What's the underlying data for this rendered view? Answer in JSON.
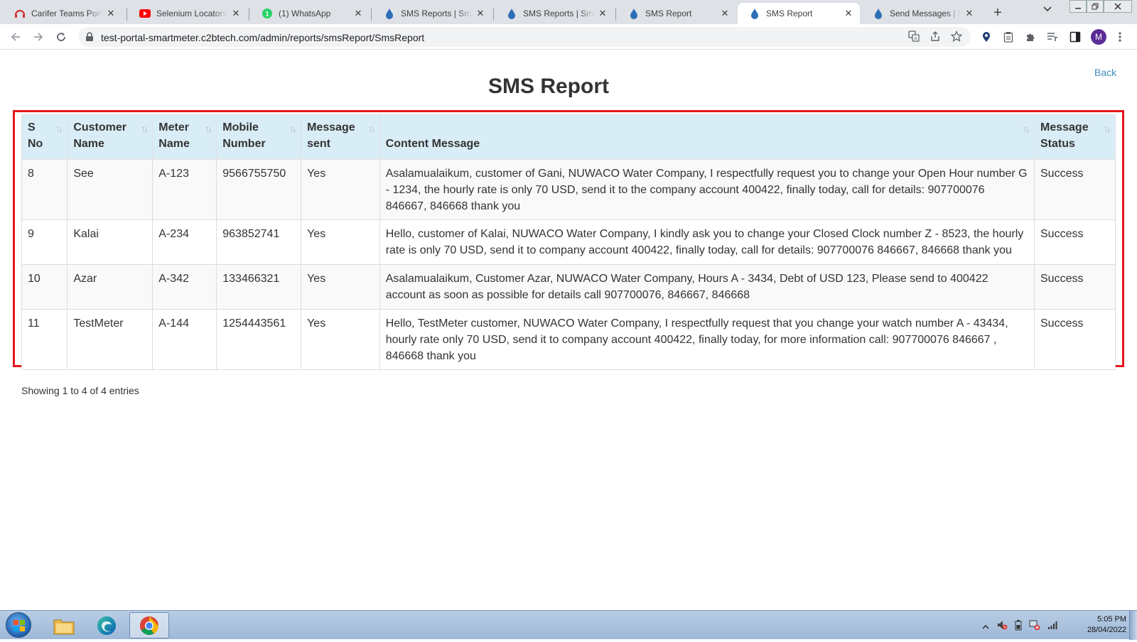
{
  "browser": {
    "tabs": [
      {
        "title": "Carifer Teams Portal",
        "icon": "headset-icon"
      },
      {
        "title": "Selenium Locators - ",
        "icon": "youtube-icon"
      },
      {
        "title": "(1) WhatsApp",
        "icon": "whatsapp-icon"
      },
      {
        "title": "SMS Reports | Smart",
        "icon": "water-drop-icon"
      },
      {
        "title": "SMS Reports | Smart",
        "icon": "water-drop-icon"
      },
      {
        "title": "SMS Report",
        "icon": "water-drop-icon"
      },
      {
        "title": "SMS Report",
        "icon": "water-drop-icon",
        "active": true
      },
      {
        "title": "Send Messages | Sm",
        "icon": "water-drop-icon"
      }
    ],
    "url": "test-portal-smartmeter.c2btech.com/admin/reports/smsReport/SmsReport",
    "profile_initial": "M"
  },
  "page": {
    "title": "SMS Report",
    "back_label": "Back"
  },
  "table": {
    "headers": [
      {
        "line1": "S",
        "line2": "No"
      },
      {
        "line1": "Customer",
        "line2": "Name"
      },
      {
        "line1": "Meter",
        "line2": "Name"
      },
      {
        "line1": "Mobile",
        "line2": "Number"
      },
      {
        "line1": "Message",
        "line2": "sent"
      },
      {
        "line1": "",
        "line2": "Content Message"
      },
      {
        "line1": "Message",
        "line2": "Status"
      }
    ],
    "rows": [
      {
        "sno": "8",
        "customer": "See",
        "meter": "A-123",
        "mobile": "9566755750",
        "sent": "Yes",
        "content": "Asalamualaikum, customer of Gani, NUWACO Water Company, I respectfully request you to change your Open Hour number G - 1234, the hourly rate is only 70 USD, send it to the company account 400422, finally today, call for details: 907700076 846667, 846668 thank you",
        "status": "Success"
      },
      {
        "sno": "9",
        "customer": "Kalai",
        "meter": "A-234",
        "mobile": "963852741",
        "sent": "Yes",
        "content": "Hello, customer of Kalai, NUWACO Water Company, I kindly ask you to change your Closed Clock number Z - 8523, the hourly rate is only 70 USD, send it to company account 400422, finally today, call for details: 907700076 846667, 846668 thank you",
        "status": "Success"
      },
      {
        "sno": "10",
        "customer": "Azar",
        "meter": "A-342",
        "mobile": "133466321",
        "sent": "Yes",
        "content": "Asalamualaikum, Customer Azar, NUWACO Water Company, Hours A - 3434, Debt of USD 123, Please send to 400422 account as soon as possible for details call 907700076, 846667, 846668",
        "status": "Success"
      },
      {
        "sno": "11",
        "customer": "TestMeter",
        "meter": "A-144",
        "mobile": "1254443561",
        "sent": "Yes",
        "content": "Hello, TestMeter customer, NUWACO Water Company, I respectfully request that you change your watch number A - 43434, hourly rate only 70 USD, send it to company account 400422, finally today, for more information call: 907700076 846667 , 846668 thank you",
        "status": "Success"
      }
    ],
    "info": "Showing 1 to 4 of 4 entries"
  },
  "taskbar": {
    "time": "5:05 PM",
    "date": "28/04/2022"
  },
  "colors": {
    "header_bg": "#d9edf7",
    "highlight_border": "#e3161e",
    "link": "#3c8dbc"
  }
}
